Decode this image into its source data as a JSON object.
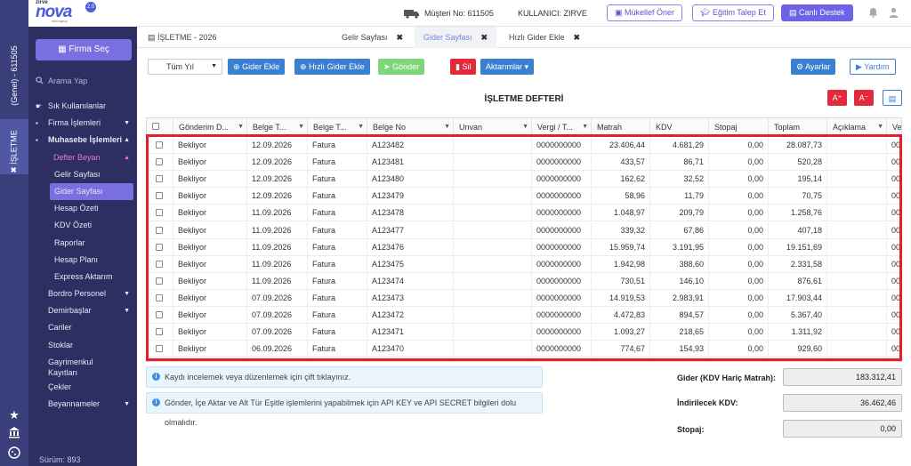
{
  "app": {
    "brand_small": "zirve",
    "brand": "nova",
    "version_badge": "2.0",
    "maker": "mikrogrup"
  },
  "rail": {
    "company": "(Genel) - 611505",
    "module": "İŞLETME",
    "close_glyph": "✖"
  },
  "header": {
    "musteri": "Müşteri No: 611505",
    "kullanici": "KULLANICI: ZIRVE",
    "buttons": [
      "Mükellef Öner",
      "Eğitim Talep Et",
      "Canlı Destek"
    ]
  },
  "sidebar": {
    "firma_button": "Firma Seç",
    "search_placeholder": "Arama Yap",
    "items": [
      {
        "label": "Sık Kullanılanlar"
      },
      {
        "label": "Firma İşlemleri"
      },
      {
        "label": "Muhasebe İşlemleri"
      },
      {
        "label": "Defter Beyan"
      },
      {
        "label": "Gelir Sayfası"
      },
      {
        "label": "Gider Sayfası"
      },
      {
        "label": "Hesap Özeti"
      },
      {
        "label": "KDV Özeti"
      },
      {
        "label": "Raporlar"
      },
      {
        "label": "Hesap Planı"
      },
      {
        "label": "Express Aktarım"
      },
      {
        "label": "Bordro Personel"
      },
      {
        "label": "Demirbaşlar"
      },
      {
        "label": "Cariler"
      },
      {
        "label": "Stoklar"
      },
      {
        "label": "Gayrimenkul Kayıtları"
      },
      {
        "label": "Çekler"
      },
      {
        "label": "Beyannameler"
      }
    ],
    "version": "Sürüm: 893"
  },
  "tabs": {
    "module_title": "İŞLETME - 2026",
    "items": [
      "Gelir Sayfası",
      "Gider Sayfası",
      "Hızlı Gider Ekle"
    ],
    "close_glyph": "✖"
  },
  "toolbar": {
    "year_select": "Tüm Yıl",
    "gider_ekle": "Gider Ekle",
    "hizli_gider_ekle": "Hızlı Gider Ekle",
    "gonder": "Gönder",
    "sil": "Sil",
    "aktarimlar": "Aktarımlar",
    "ayarlar": "Ayarlar",
    "yardim": "Yardım"
  },
  "page_title": "İŞLETME DEFTERİ",
  "font_buttons": {
    "bigger": "A⁺",
    "smaller": "A⁻"
  },
  "table": {
    "columns": [
      "Gönderim D...",
      "Belge T...",
      "Belge T...",
      "Belge No",
      "Unvan",
      "Vergi / T...",
      "Matrah",
      "KDV",
      "Stopaj",
      "Toplam",
      "Açıklama",
      "Ve"
    ],
    "rows": [
      [
        "Bekliyor",
        "12.09.2026",
        "Fatura",
        "A123482",
        "",
        "0000000000",
        "23.406,44",
        "4.681,29",
        "0,00",
        "28.087,73",
        "",
        "00"
      ],
      [
        "Bekliyor",
        "12.09.2026",
        "Fatura",
        "A123481",
        "",
        "0000000000",
        "433,57",
        "86,71",
        "0,00",
        "520,28",
        "",
        "00"
      ],
      [
        "Bekliyor",
        "12.09.2026",
        "Fatura",
        "A123480",
        "",
        "0000000000",
        "162,62",
        "32,52",
        "0,00",
        "195,14",
        "",
        "00"
      ],
      [
        "Bekliyor",
        "12.09.2026",
        "Fatura",
        "A123479",
        "",
        "0000000000",
        "58,96",
        "11,79",
        "0,00",
        "70,75",
        "",
        "00"
      ],
      [
        "Bekliyor",
        "11.09.2026",
        "Fatura",
        "A123478",
        "",
        "0000000000",
        "1.048,97",
        "209,79",
        "0,00",
        "1.258,76",
        "",
        "00"
      ],
      [
        "Bekliyor",
        "11.09.2026",
        "Fatura",
        "A123477",
        "",
        "0000000000",
        "339,32",
        "67,86",
        "0,00",
        "407,18",
        "",
        "00"
      ],
      [
        "Bekliyor",
        "11.09.2026",
        "Fatura",
        "A123476",
        "",
        "0000000000",
        "15.959,74",
        "3.191,95",
        "0,00",
        "19.151,69",
        "",
        "00"
      ],
      [
        "Bekliyor",
        "11.09.2026",
        "Fatura",
        "A123475",
        "",
        "0000000000",
        "1.942,98",
        "388,60",
        "0,00",
        "2.331,58",
        "",
        "00"
      ],
      [
        "Bekliyor",
        "11.09.2026",
        "Fatura",
        "A123474",
        "",
        "0000000000",
        "730,51",
        "146,10",
        "0,00",
        "876,61",
        "",
        "00"
      ],
      [
        "Bekliyor",
        "07.09.2026",
        "Fatura",
        "A123473",
        "",
        "0000000000",
        "14.919,53",
        "2.983,91",
        "0,00",
        "17.903,44",
        "",
        "00"
      ],
      [
        "Bekliyor",
        "07.09.2026",
        "Fatura",
        "A123472",
        "",
        "0000000000",
        "4.472,83",
        "894,57",
        "0,00",
        "5.367,40",
        "",
        "00"
      ],
      [
        "Bekliyor",
        "07.09.2026",
        "Fatura",
        "A123471",
        "",
        "0000000000",
        "1.093,27",
        "218,65",
        "0,00",
        "1.311,92",
        "",
        "00"
      ],
      [
        "Bekliyor",
        "06.09.2026",
        "Fatura",
        "A123470",
        "",
        "0000000000",
        "774,67",
        "154,93",
        "0,00",
        "929,60",
        "",
        "00"
      ]
    ]
  },
  "info": [
    "Kaydı incelemek veya düzenlemek için çift tıklayınız.",
    "Gönder, İçe Aktar ve Alt Tür Eşitle işlemlerini yapabilmek için API KEY ve API SECRET bilgileri dolu olmalıdır."
  ],
  "totals": [
    {
      "label": "Gider (KDV Hariç Matrah):",
      "value": "183.312,41"
    },
    {
      "label": "İndirilecek KDV:",
      "value": "36.462,46"
    },
    {
      "label": "Stopaj:",
      "value": "0,00"
    }
  ]
}
